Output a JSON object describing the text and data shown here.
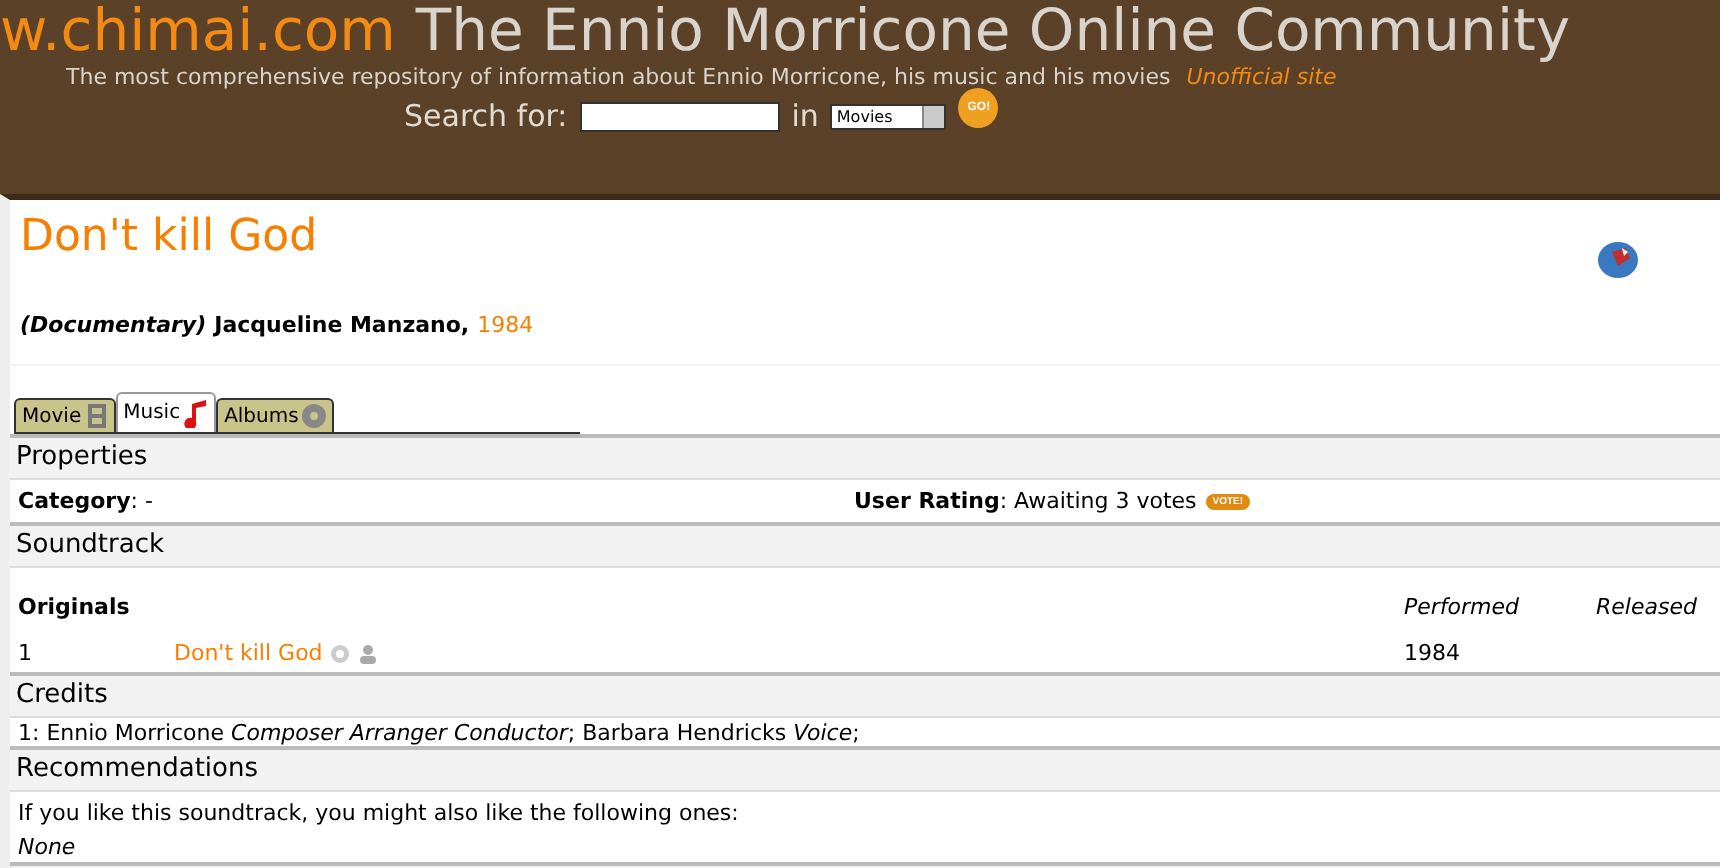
{
  "header": {
    "site": "w.chimai.com",
    "title": "The Ennio Morricone Online Community",
    "tagline": "The most comprehensive repository of information about Ennio Morricone, his music and his movies",
    "unofficial": "Unofficial site",
    "search_label": "Search for:",
    "in_label": "in",
    "scope": "Movies",
    "go": "GO!"
  },
  "movie": {
    "title": "Don't kill God",
    "genre": "(Documentary)",
    "director": "Jacqueline Manzano,",
    "year": "1984"
  },
  "tabs": [
    {
      "label": "Movie",
      "kind": "film",
      "selected": false
    },
    {
      "label": "Music",
      "kind": "note",
      "selected": true
    },
    {
      "label": "Albums",
      "kind": "disc",
      "selected": false
    }
  ],
  "properties": {
    "heading": "Properties",
    "category": "**Category**: -",
    "rating": "**User Rating**: Awaiting 3 votes",
    "vote": "VOTE!"
  },
  "soundtrack": {
    "heading": "Soundtrack",
    "group": "Originals",
    "col_performed": "Performed",
    "col_released": "Released",
    "rows": [
      {
        "number": "1",
        "title": "Don't kill God",
        "performed": "1984"
      }
    ]
  },
  "credits": {
    "heading": "Credits",
    "text": "1: Ennio Morricone *Composer Arranger Conductor*; Barbara Hendricks *Voice*;"
  },
  "recommendations": {
    "heading": "Recommendations",
    "intro": "If you like this soundtrack, you might also like the following ones:",
    "none": "None"
  }
}
